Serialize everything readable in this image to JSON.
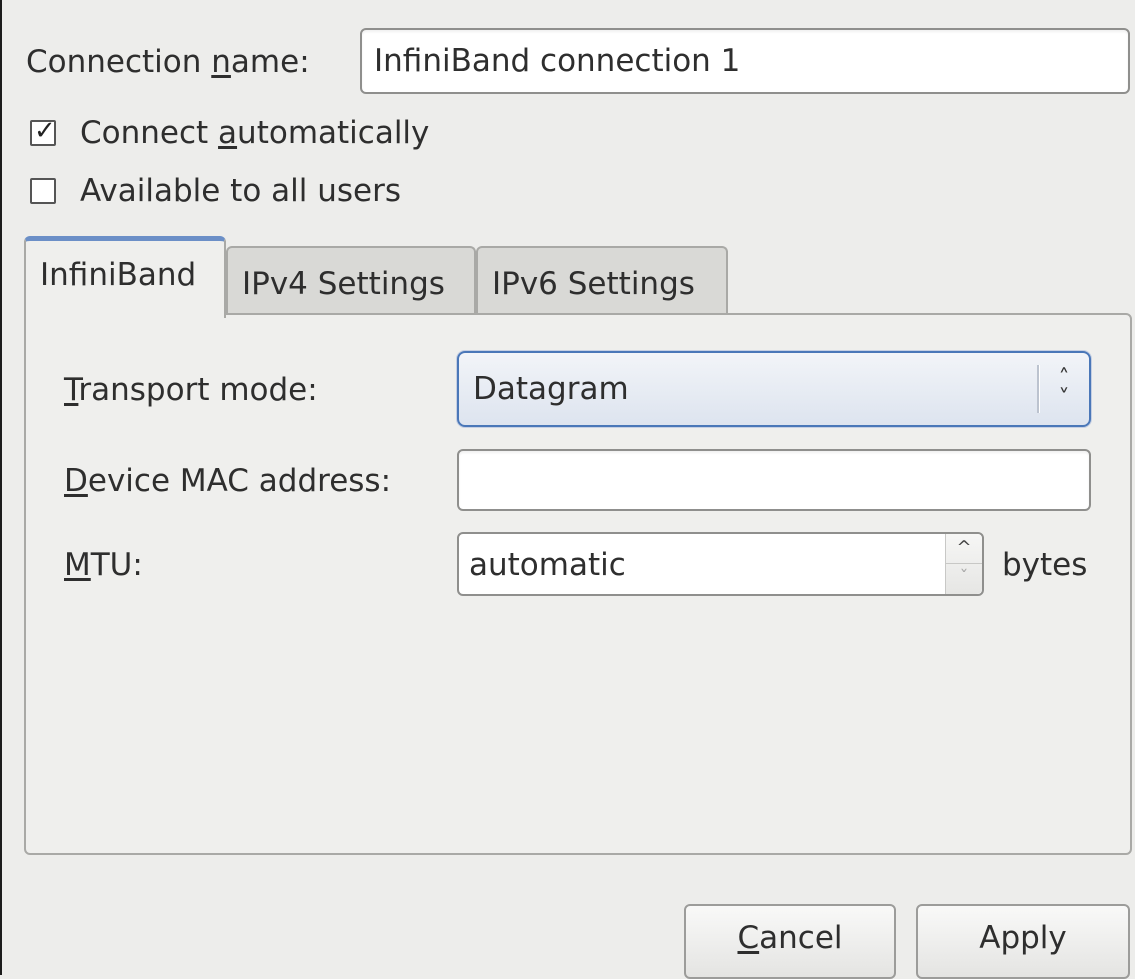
{
  "connection": {
    "name_label_prefix": "Connection ",
    "name_label_mnemonic": "n",
    "name_label_suffix": "ame:",
    "name_value": "InfiniBand connection 1"
  },
  "options": {
    "auto_prefix": "Connect ",
    "auto_mnemonic": "a",
    "auto_suffix": "utomatically",
    "auto_checked": true,
    "all_users_label": "Available to all users",
    "all_users_checked": false,
    "check_glyph": "✓"
  },
  "tabs": [
    {
      "label": "InfiniBand",
      "active": true
    },
    {
      "label": "IPv4 Settings",
      "active": false
    },
    {
      "label": "IPv6 Settings",
      "active": false
    }
  ],
  "infiniband": {
    "transport_mnemonic": "T",
    "transport_suffix": "ransport mode:",
    "transport_value": "Datagram",
    "mac_mnemonic": "D",
    "mac_suffix": "evice MAC address:",
    "mac_value": "",
    "mtu_mnemonic": "M",
    "mtu_suffix": "TU:",
    "mtu_value": "automatic",
    "mtu_unit": "bytes"
  },
  "icons": {
    "combo_up": "˄",
    "combo_down": "˅",
    "spin_up": "^",
    "spin_down": "ˇ"
  },
  "buttons": {
    "cancel_mnemonic": "C",
    "cancel_suffix": "ancel",
    "apply_label": "Apply"
  },
  "colors": {
    "active_tab_accent": "#6b8fc7",
    "combo_focus_border": "#4a77b8"
  }
}
